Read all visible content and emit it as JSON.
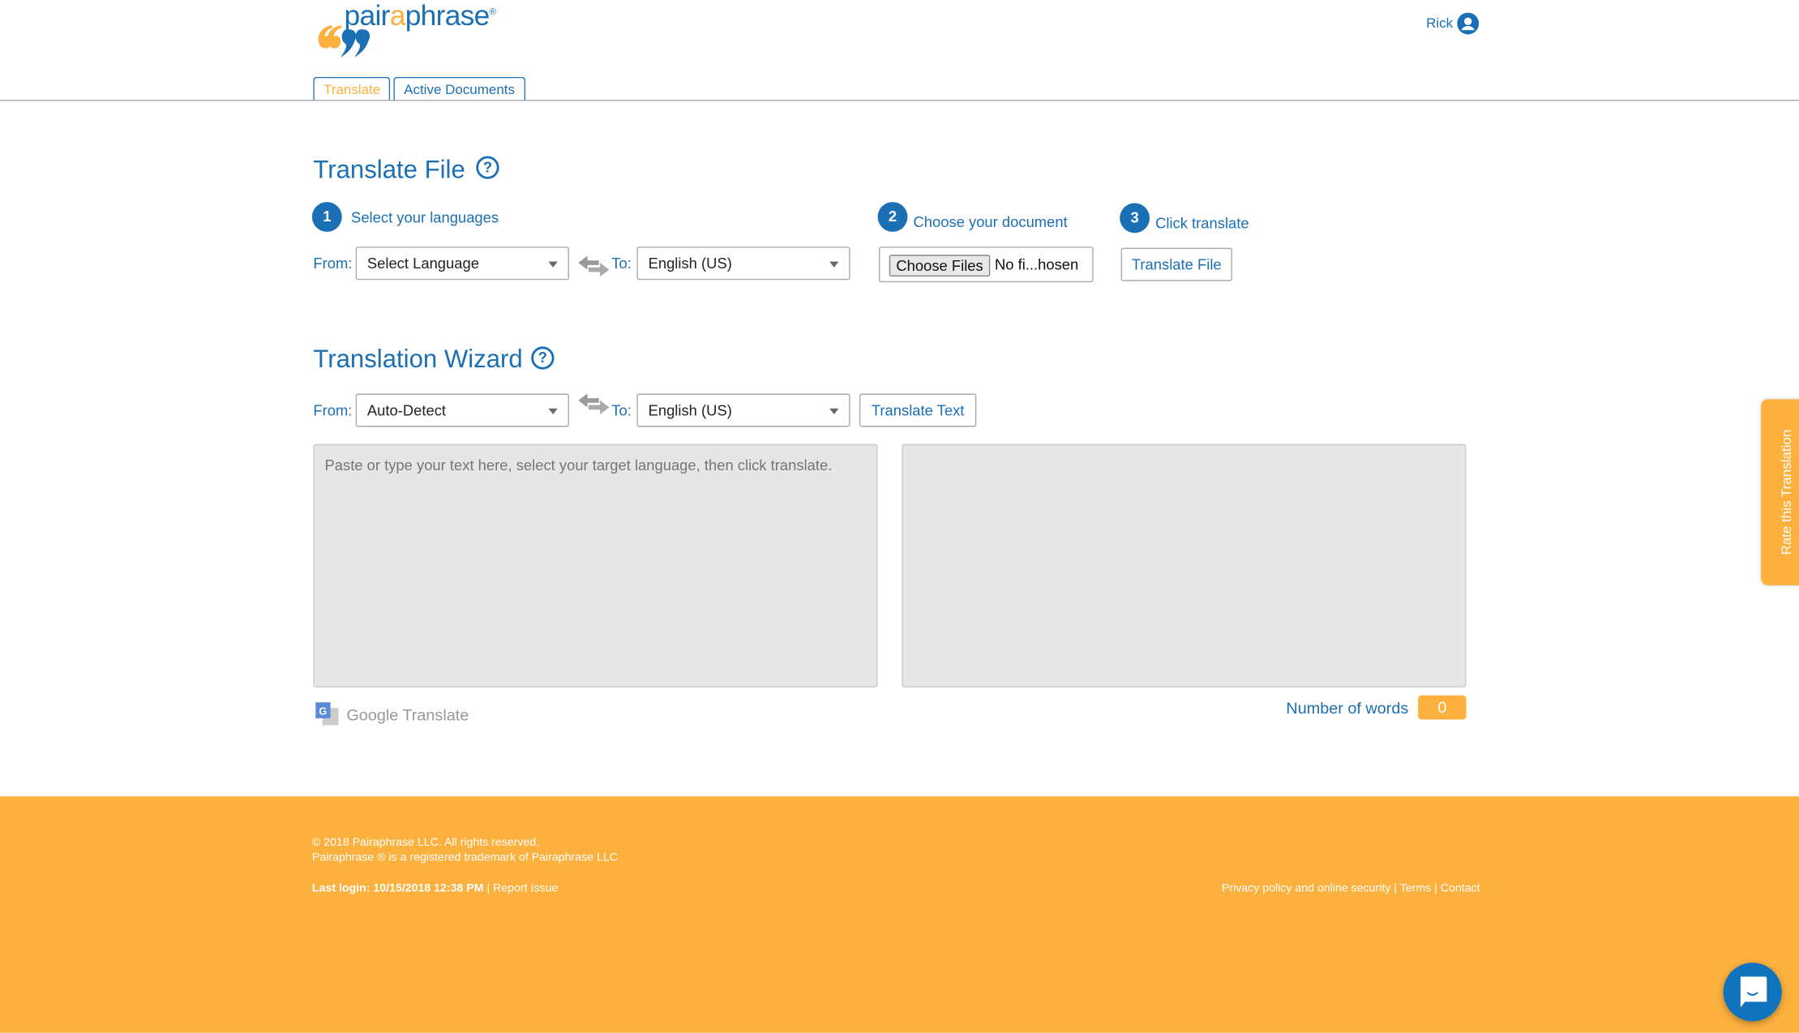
{
  "brand": {
    "name_pre": "pair",
    "name_a": "a",
    "name_post": "phrase",
    "reg": "®",
    "orange": "#fcb03d",
    "blue": "#1a6fb5"
  },
  "user": {
    "name": "Rick",
    "icon": "user-circle-icon"
  },
  "tabs": [
    {
      "label": "Translate",
      "active": true
    },
    {
      "label": "Active Documents",
      "active": false
    }
  ],
  "translate_file": {
    "title": "Translate File",
    "help": "?",
    "steps": [
      {
        "num": "1",
        "label": "Select your languages"
      },
      {
        "num": "2",
        "label": "Choose your document"
      },
      {
        "num": "3",
        "label": "Click translate"
      }
    ],
    "from_label": "From:",
    "from_value": "Select Language",
    "to_label": "To:",
    "to_value": "English (US)",
    "choose_files": "Choose Files",
    "file_status": "No fi...hosen",
    "translate_button": "Translate File"
  },
  "wizard": {
    "title": "Translation Wizard",
    "help": "?",
    "from_label": "From:",
    "from_value": "Auto-Detect",
    "to_label": "To:",
    "to_value": "English (US)",
    "translate_button": "Translate Text",
    "source_placeholder": "Paste or type your text here, select your target language, then click translate.",
    "powered_by": "Google Translate",
    "word_count_label": "Number of words",
    "word_count": "0"
  },
  "rate_tab": "Rate this Translation",
  "footer": {
    "copyright": "© 2018 Pairaphrase LLC. All rights reserved.",
    "trademark": "Pairaphrase ® is a registered trademark of Pairaphrase LLC",
    "last_login": "Last login: 10/15/2018 12:38 PM",
    "sep": "|",
    "report": "Report Issue",
    "privacy": "Privacy policy and online security",
    "terms": "Terms",
    "contact": "Contact"
  }
}
